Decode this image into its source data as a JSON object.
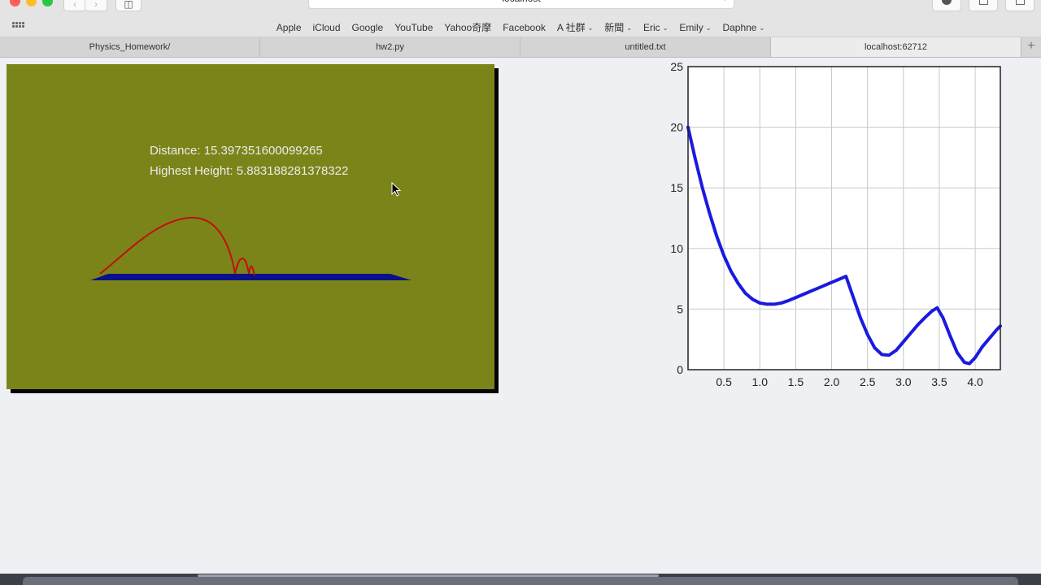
{
  "browser": {
    "address": "localhost",
    "favorites": [
      "Apple",
      "iCloud",
      "Google",
      "YouTube",
      "Yahoo奇摩",
      "Facebook",
      "A 社群",
      "新聞",
      "Eric",
      "Emily",
      "Daphne"
    ],
    "favorites_with_menu": [
      "A 社群",
      "新聞",
      "Eric",
      "Emily",
      "Daphne"
    ],
    "tabs": [
      {
        "label": "Physics_Homework/",
        "active": false
      },
      {
        "label": "hw2.py",
        "active": false
      },
      {
        "label": "untitled.txt",
        "active": false
      },
      {
        "label": "localhost:62712",
        "active": true
      }
    ]
  },
  "scene": {
    "distance_label": "Distance: 15.397351600099265",
    "height_label": "Highest Height: 5.883188281378322",
    "background_color": "#7b8419",
    "floor_color": "#0a0f8a",
    "trail_color": "#c0100a"
  },
  "chart_data": {
    "type": "line",
    "color": "#1a1adf",
    "xlim": [
      0.0,
      4.35
    ],
    "ylim": [
      0,
      25
    ],
    "xticks": [
      0.5,
      1.0,
      1.5,
      2.0,
      2.5,
      3.0,
      3.5,
      4.0
    ],
    "yticks": [
      0,
      5,
      10,
      15,
      20,
      25
    ],
    "grid": true,
    "x": [
      0.0,
      0.1,
      0.2,
      0.3,
      0.4,
      0.5,
      0.6,
      0.7,
      0.8,
      0.9,
      1.0,
      1.1,
      1.2,
      1.3,
      1.4,
      1.5,
      1.6,
      1.7,
      1.8,
      1.9,
      2.0,
      2.1,
      2.2,
      2.3,
      2.4,
      2.5,
      2.6,
      2.7,
      2.8,
      2.9,
      3.0,
      3.1,
      3.2,
      3.3,
      3.4,
      3.47,
      3.55,
      3.65,
      3.75,
      3.85,
      3.92,
      4.0,
      4.1,
      4.2,
      4.3,
      4.35
    ],
    "y": [
      20.0,
      17.4,
      15.0,
      12.9,
      11.0,
      9.4,
      8.1,
      7.1,
      6.3,
      5.8,
      5.5,
      5.4,
      5.4,
      5.5,
      5.7,
      5.95,
      6.2,
      6.45,
      6.7,
      6.95,
      7.2,
      7.45,
      7.7,
      6.0,
      4.3,
      2.9,
      1.8,
      1.25,
      1.2,
      1.6,
      2.3,
      3.0,
      3.7,
      4.3,
      4.85,
      5.1,
      4.3,
      2.8,
      1.4,
      0.6,
      0.5,
      1.0,
      1.9,
      2.6,
      3.3,
      3.6
    ]
  }
}
